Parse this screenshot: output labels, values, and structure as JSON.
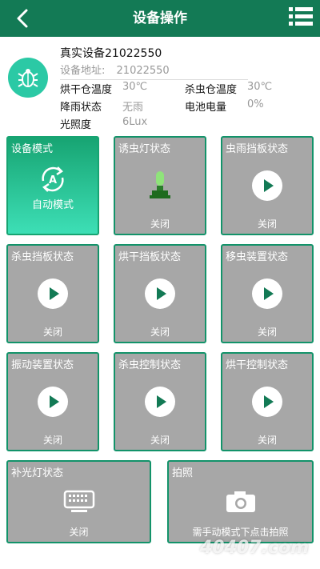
{
  "header": {
    "title": "设备操作"
  },
  "device": {
    "name": "真实设备21022550",
    "address_label": "设备地址:",
    "address": "21022550",
    "fields": [
      {
        "key": "烘干仓温度",
        "value": "30℃"
      },
      {
        "key": "杀虫仓温度",
        "value": "30℃"
      },
      {
        "key": "降雨状态",
        "value": "无雨"
      },
      {
        "key": "电池电量",
        "value": "0%"
      },
      {
        "key": "光照度",
        "value": "6Lux"
      }
    ]
  },
  "tiles": [
    {
      "label": "设备模式",
      "status": "自动模式"
    },
    {
      "label": "诱虫灯状态",
      "status": "关闭"
    },
    {
      "label": "虫雨挡板状态",
      "status": "关闭"
    },
    {
      "label": "杀虫挡板状态",
      "status": "关闭"
    },
    {
      "label": "烘干挡板状态",
      "status": "关闭"
    },
    {
      "label": "移虫装置状态",
      "status": "关闭"
    },
    {
      "label": "振动装置状态",
      "status": "关闭"
    },
    {
      "label": "杀虫控制状态",
      "status": "关闭"
    },
    {
      "label": "烘干控制状态",
      "status": "关闭"
    },
    {
      "label": "补光灯状态",
      "status": "关闭"
    },
    {
      "label": "拍照",
      "status": "需手动模式下点击拍照"
    }
  ],
  "colors": {
    "header": "#137a55",
    "accent": "#2bc9a5",
    "tile": "#a7a7a7",
    "tile_border": "#13936a"
  },
  "watermark": "40407.com"
}
